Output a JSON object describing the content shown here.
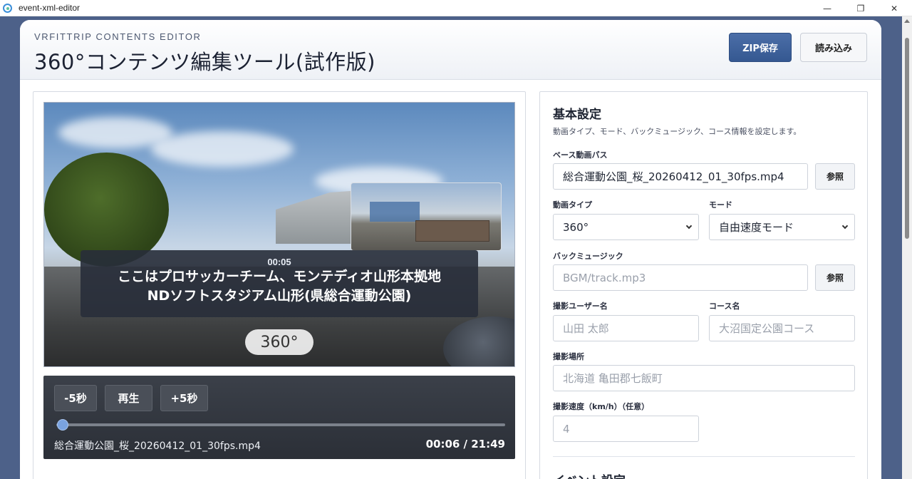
{
  "window": {
    "title": "event-xml-editor",
    "minimize": "—",
    "restore": "❐",
    "close": "✕"
  },
  "header": {
    "eyebrow": "VRFITTRIP CONTENTS EDITOR",
    "title": "360°コンテンツ編集ツール(試作版)",
    "zip_button": "ZIP保存",
    "load_button": "読み込み"
  },
  "player": {
    "caption_time": "00:05",
    "caption_line1": "ここはプロサッカーチーム、モンテディオ山形本拠地",
    "caption_line2": "NDソフトスタジアム山形(県総合運動公園)",
    "mode_badge": "360°",
    "back_button": "-5秒",
    "play_button": "再生",
    "forward_button": "+5秒",
    "progress": 0.005,
    "file_name": "総合運動公園_桜_20260412_01_30fps.mp4",
    "time_readout": "00:06 / 21:49"
  },
  "settings": {
    "title": "基本設定",
    "description": "動画タイプ、モード、バックミュージック、コース情報を設定します。",
    "base_video_label": "ベース動画パス",
    "base_video_value": "総合運動公園_桜_20260412_01_30fps.mp4",
    "browse": "参照",
    "video_type_label": "動画タイプ",
    "video_type_value": "360°",
    "mode_label": "モード",
    "mode_value": "自由速度モード",
    "bgm_label": "バックミュージック",
    "bgm_placeholder": "BGM/track.mp3",
    "user_label": "撮影ユーザー名",
    "user_placeholder": "山田 太郎",
    "course_label": "コース名",
    "course_placeholder": "大沼国定公園コース",
    "place_label": "撮影場所",
    "place_placeholder": "北海道 亀田郡七飯町",
    "speed_label": "撮影速度（km/h）（任意）",
    "speed_placeholder": "4",
    "next_section": "イベント設定"
  }
}
